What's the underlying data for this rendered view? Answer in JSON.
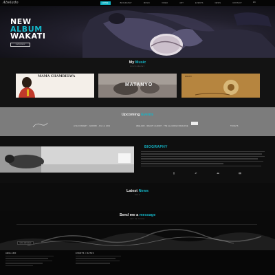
{
  "nav": {
    "logo": "Abelado",
    "items": [
      "HOME",
      "BIOGRAPHY",
      "MUSIC",
      "VIDEO",
      "ART",
      "EVENTS",
      "NEWS",
      "CONTACT"
    ],
    "active_index": 0,
    "language": "EN",
    "accent_color": "#14b7c9"
  },
  "hero": {
    "line1": "NEW",
    "line2": "ALBUM",
    "line3": "WAKATI",
    "button_label": "LISTEN NOW",
    "background_colors": [
      "#3e3a52",
      "#211f2c",
      "#0d0d12"
    ]
  },
  "music": {
    "title": "My",
    "title_accent": "Music",
    "subtitle": "DISCOGRAPHY",
    "albums": [
      {
        "caption": "MAMA CHAMBELWA"
      },
      {
        "caption": "MATANYO"
      },
      {
        "caption": "WAKATI"
      }
    ]
  },
  "upcoming": {
    "title": "Upcoming",
    "title_accent": "Events",
    "events": [
      "LIVE CONCERT · NAIROBI · JUL 12, 2019",
      "ABELADO · WAKATI LAUNCH · THE ALLIANCE FRANCAISE",
      "TICKETS"
    ],
    "background": "#7c7c7c"
  },
  "bio": {
    "title": "BIOGRAPHY"
  },
  "news": {
    "title": "Latest",
    "title_accent": "News",
    "subtitle": "BLOG"
  },
  "contact": {
    "title": "Send me a",
    "title_accent": "message",
    "subtitle": "GET IN TOUCH",
    "send_label": "SEND MESSAGE"
  },
  "footer": {
    "col1_title": "ABELADO",
    "col2_title": "EVENTS / DATES"
  }
}
